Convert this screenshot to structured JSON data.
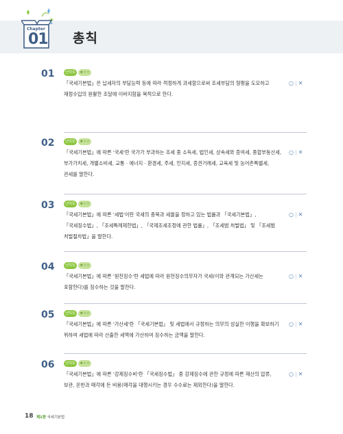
{
  "header": {
    "chapter_label": "Chapter",
    "chapter_number": "01",
    "title": "총칙"
  },
  "questions": [
    {
      "number": "01",
      "level": "난이도",
      "stars": "★☆☆",
      "text": "「국세기본법」은 납세자의 부담능력 등에 따라 적정하게 과세함으로써 조세부담의 형평을 도모하고 재정수입의 원활한 조달에 이바지함을 목적으로 한다.",
      "o": "○",
      "sep": "|",
      "x": "✕"
    },
    {
      "number": "02",
      "level": "난이도",
      "stars": "★☆☆",
      "text": "「국세기본법」에 따른 '국세'란 국가가 부과하는 조세 중 소득세, 법인세, 상속세와 증여세, 종합부동산세, 부가가치세, 개별소비세, 교통 · 에너지 · 환경세, 주세, 인지세, 증권거래세, 교육세 및 농어촌특별세, 관세를 말한다.",
      "o": "○",
      "sep": "|",
      "x": "✕"
    },
    {
      "number": "03",
      "level": "난이도",
      "stars": "★☆☆",
      "text": "「국세기본법」에 따른 '세법'이란 국세의 종목과 세율을 정하고 있는 법률과 「국세기본법」, 「국세징수법」, 「조세특례제한법」, 「국제조세조정에 관한 법률」, 「조세범 처벌법」 및 「조세범 처벌절차법」을 말한다.",
      "o": "○",
      "sep": "|",
      "x": "✕"
    },
    {
      "number": "04",
      "level": "난이도",
      "stars": "★☆☆",
      "text": "「국세기본법」에 따른 '원천징수'란 세법에 따라 원천징수의무자가 국세(이와 관계되는 가산세는 포함한다)를 징수하는 것을 말한다.",
      "o": "○",
      "sep": "|",
      "x": "✕"
    },
    {
      "number": "05",
      "level": "난이도",
      "stars": "★☆☆",
      "text": "「국세기본법」에 따른 '가산세'란 「국세기본법」 및 세법에서 규정하는 의무의 성실한 이행을 확보하기 위하여 세법에 따라 산출한 세액에 가산하여 징수하는 금액을 말한다.",
      "o": "○",
      "sep": "|",
      "x": "✕"
    },
    {
      "number": "06",
      "level": "난이도",
      "stars": "★☆☆",
      "text": "「국세기본법」에 따른 '강제징수비'란 「국세징수법」 중 강제징수에 관한 규정에 따른 재산의 압류, 보관, 운반과 매각에 든 비용(매각을 대행시키는 경우 수수료는 제외한다)을 말한다.",
      "o": "○",
      "sep": "|",
      "x": "✕"
    }
  ],
  "footer": {
    "page_number": "18",
    "part": "제1편",
    "section": "국세기본법"
  },
  "colors": {
    "accent_blue": "#3f5f86",
    "accent_green": "#8cc63f",
    "header_band": "#eef1f4"
  }
}
